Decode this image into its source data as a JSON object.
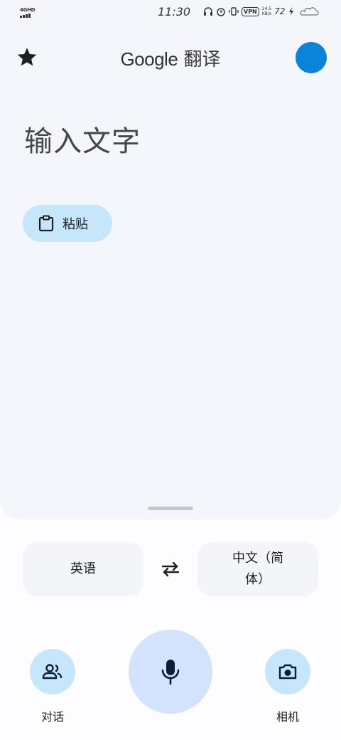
{
  "status_bar": {
    "network": "4GHD",
    "time": "11:30",
    "vpn": "VPN",
    "speed_value": "24.5",
    "speed_unit": "KB/s",
    "battery": "72"
  },
  "header": {
    "brand": "Google",
    "title_suffix": "翻译",
    "avatar_color": "#0a84d8"
  },
  "input": {
    "placeholder": "输入文字"
  },
  "paste": {
    "label": "粘贴",
    "icon": "clipboard-icon"
  },
  "languages": {
    "source": "英语",
    "target": "中文（简体）",
    "swap_icon": "swap-arrows-icon"
  },
  "actions": {
    "conversation_label": "对话",
    "camera_label": "相机",
    "mic_icon": "microphone-icon"
  },
  "colors": {
    "accent_light": "#c5e6fb",
    "mic_bg": "#d3e3fd",
    "icon_dark": "#0b1d3a"
  }
}
